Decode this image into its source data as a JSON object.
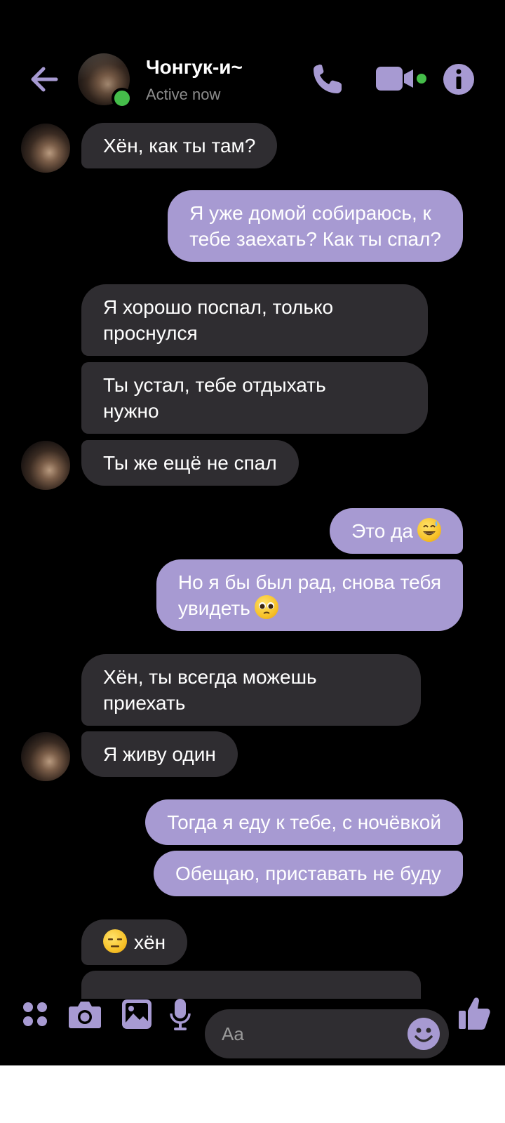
{
  "header": {
    "contact_name": "Чонгук-и~",
    "status": "Active now"
  },
  "messages": [
    {
      "from": "them",
      "text": "Хён, как ты там?"
    },
    {
      "from": "me",
      "lines": [
        "Я уже домой собираюсь, к",
        "тебе заехать? Как ты спал?"
      ]
    },
    {
      "from": "them",
      "lines": [
        "Я хорошо поспал, только",
        "проснулся"
      ]
    },
    {
      "from": "them",
      "lines": [
        "Ты устал, тебе отдыхать",
        "нужно"
      ]
    },
    {
      "from": "them",
      "text": "Ты же ещё не спал"
    },
    {
      "from": "me",
      "text": "Это да",
      "emoji": "grinning-face-with-sweat"
    },
    {
      "from": "me",
      "lines": [
        "Но я бы был рад, снова тебя",
        "увидеть"
      ],
      "emoji": "pleading-face"
    },
    {
      "from": "them",
      "lines": [
        "Хён, ты всегда можешь",
        "приехать"
      ]
    },
    {
      "from": "them",
      "text": "Я живу один"
    },
    {
      "from": "me",
      "text": "Тогда я еду к тебе, с ночёвкой"
    },
    {
      "from": "me",
      "text": "Обещаю, приставать не буду"
    },
    {
      "from": "them",
      "text": "хён",
      "emoji": "expressionless-face"
    }
  ],
  "composer": {
    "placeholder": "Aa"
  },
  "icons": {
    "back": "back-arrow-icon",
    "call": "phone-icon",
    "video": "video-camera-icon",
    "info": "info-icon",
    "more": "apps-icon",
    "camera": "camera-icon",
    "gallery": "image-icon",
    "mic": "microphone-icon",
    "emoji": "smiley-icon",
    "like": "thumbs-up-icon"
  },
  "colors": {
    "accent": "#a79ad2",
    "incoming_bubble": "#2f2d31",
    "online": "#45bd4a"
  }
}
